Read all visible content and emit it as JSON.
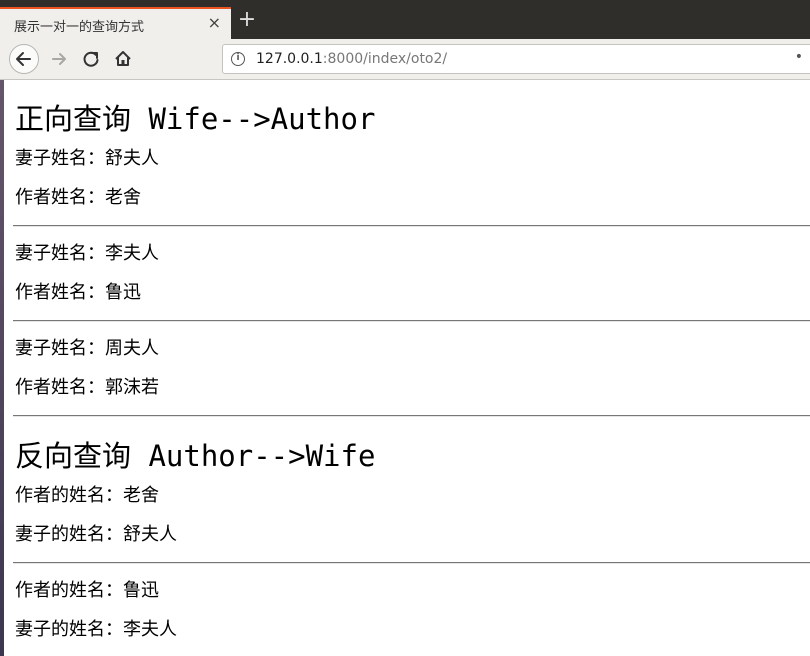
{
  "browser": {
    "tab_title": "展示一对一的查询方式",
    "tab_close": "×",
    "new_tab": "+",
    "url_host": "127.0.0.1",
    "url_rest": ":8000/index/oto2/"
  },
  "page": {
    "forward_heading": "正向查询 Wife-->Author",
    "forward_records": [
      {
        "wife_line": "妻子姓名：舒夫人",
        "author_line": "作者姓名：老舍"
      },
      {
        "wife_line": "妻子姓名：李夫人",
        "author_line": "作者姓名：鲁迅"
      },
      {
        "wife_line": "妻子姓名：周夫人",
        "author_line": "作者姓名：郭沫若"
      }
    ],
    "reverse_heading": "反向查询 Author-->Wife",
    "reverse_records": [
      {
        "author_line": "作者的姓名：老舍",
        "wife_line": "妻子的姓名：舒夫人"
      },
      {
        "author_line": "作者的姓名：鲁迅",
        "wife_line": "妻子的姓名：李夫人"
      }
    ]
  }
}
